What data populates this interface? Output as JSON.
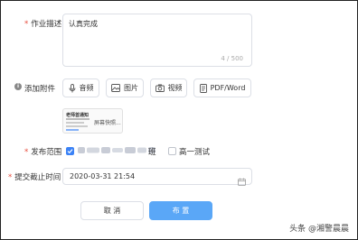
{
  "form": {
    "description": {
      "label": "作业描述",
      "value": "认真完成",
      "counter": "4 / 500"
    },
    "attachments": {
      "label": "添加附件",
      "info_icon_text": "i",
      "buttons": [
        {
          "label": "音频",
          "icon": "microphone-icon"
        },
        {
          "label": "图片",
          "icon": "image-icon"
        },
        {
          "label": "视频",
          "icon": "camera-icon"
        },
        {
          "label": "PDF/Word",
          "icon": "document-icon"
        }
      ],
      "thumbnail": {
        "title": "老师首通知",
        "caption": "屏幕快照..."
      }
    },
    "scope": {
      "label": "发布范围",
      "options": [
        {
          "label": "班",
          "checked": true
        },
        {
          "label": "高一测试",
          "checked": false
        }
      ]
    },
    "deadline": {
      "label": "提交截止时间",
      "value": "2020-03-31 21:54",
      "icon": "calendar-icon"
    },
    "actions": {
      "cancel_label": "取 消",
      "submit_label": "布 置"
    }
  },
  "watermark": "头条 @湘警晨晨",
  "colors": {
    "primary": "#3b82f6",
    "required": "#e74c3c",
    "border": "#dcdfe6"
  }
}
